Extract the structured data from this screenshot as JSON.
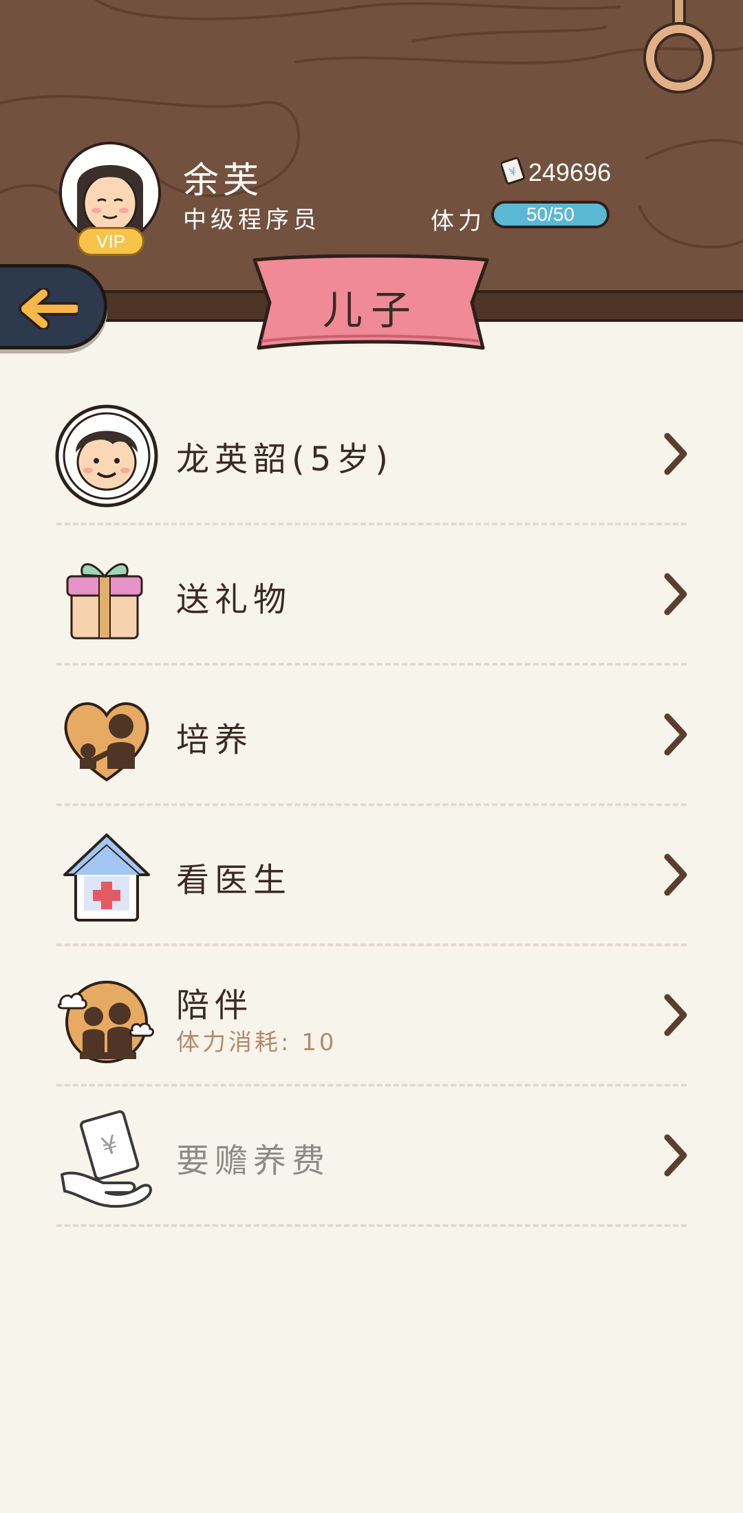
{
  "player": {
    "name": "余芙",
    "title": "中级程序员",
    "vip_label": "VIP",
    "money": "249696",
    "stamina_label": "体力",
    "stamina_value": "50/50"
  },
  "page": {
    "title": "儿子"
  },
  "menu": [
    {
      "label": "龙英韶(5岁)",
      "icon": "child-avatar-icon"
    },
    {
      "label": "送礼物",
      "icon": "gift-icon"
    },
    {
      "label": "培养",
      "icon": "heart-parent-child-icon"
    },
    {
      "label": "看医生",
      "icon": "hospital-icon"
    },
    {
      "label": "陪伴",
      "sublabel": "体力消耗: 10",
      "icon": "companion-icon"
    },
    {
      "label": "要赡养费",
      "icon": "money-hand-icon"
    }
  ],
  "colors": {
    "header_wood": "#72513e",
    "ribbon": "#f08a96",
    "stamina": "#5bb8d4",
    "background": "#f7f4ec"
  }
}
